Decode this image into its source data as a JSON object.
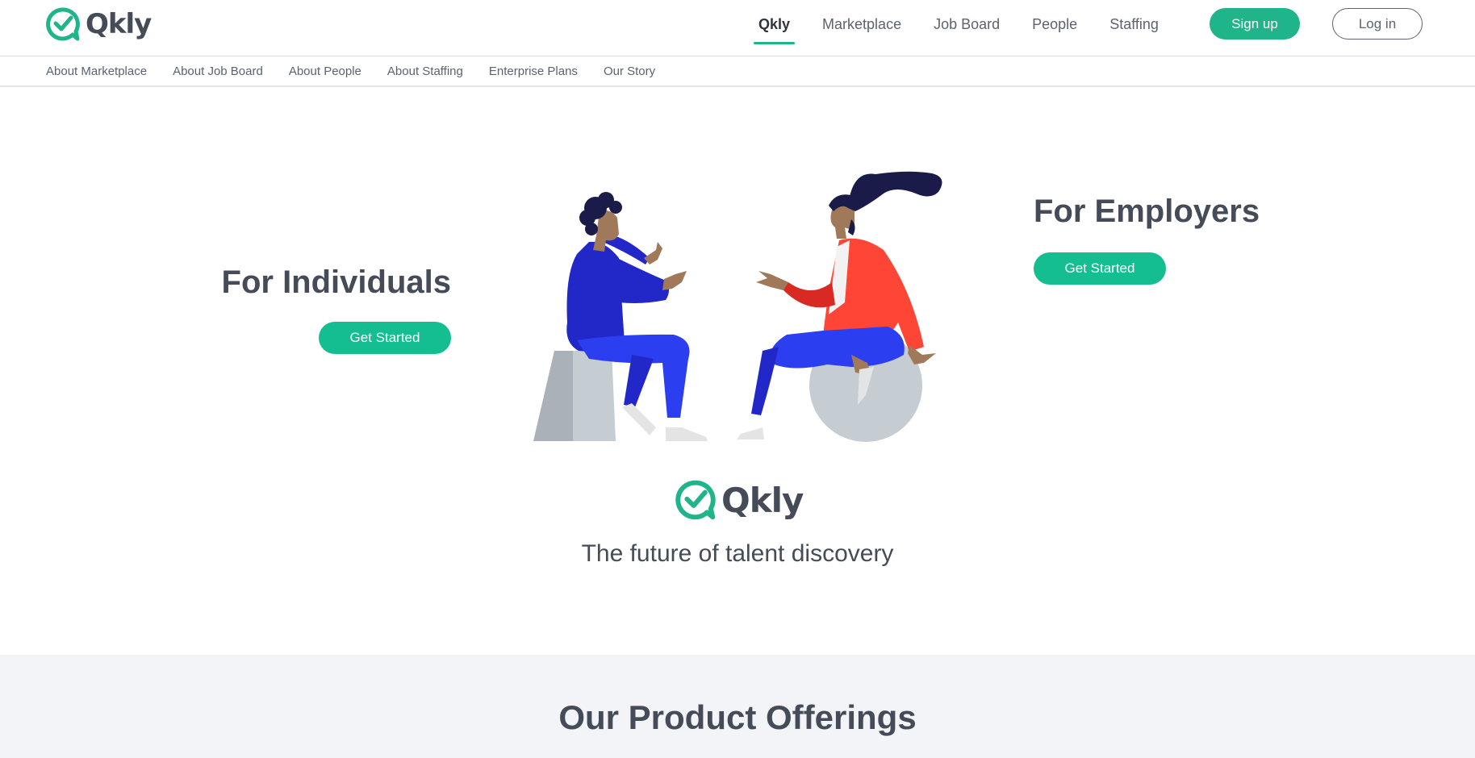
{
  "header": {
    "brand": "Qkly",
    "nav": [
      {
        "label": "Qkly",
        "active": true
      },
      {
        "label": "Marketplace",
        "active": false
      },
      {
        "label": "Job Board",
        "active": false
      },
      {
        "label": "People",
        "active": false
      },
      {
        "label": "Staffing",
        "active": false
      }
    ],
    "signup_label": "Sign up",
    "login_label": "Log in"
  },
  "subnav": [
    "About Marketplace",
    "About Job Board",
    "About People",
    "About Staffing",
    "Enterprise Plans",
    "Our Story"
  ],
  "hero": {
    "individuals_title": "For Individuals",
    "individuals_button": "Get Started",
    "employers_title": "For Employers",
    "employers_button": "Get Started",
    "center_brand": "Qkly",
    "tagline": "The future of talent discovery"
  },
  "offerings": {
    "title": "Our Product Offerings"
  },
  "colors": {
    "accent": "#20b48a",
    "text": "#454b57",
    "band": "#f3f4f8"
  },
  "icons": {
    "logo": "qkly-check-bubble-icon"
  }
}
